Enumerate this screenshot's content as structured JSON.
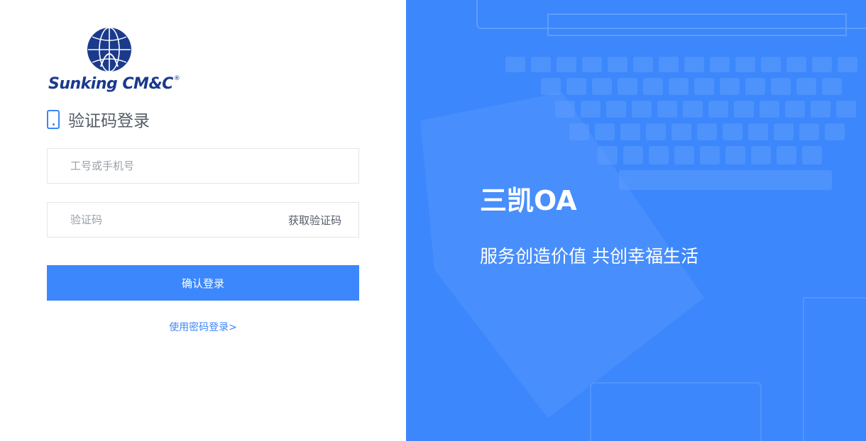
{
  "logo": {
    "text": "Sunking CM&C",
    "registered_mark": "®"
  },
  "login": {
    "title": "验证码登录",
    "username_placeholder": "工号或手机号",
    "code_placeholder": "验证码",
    "get_code_label": "获取验证码",
    "submit_label": "确认登录",
    "switch_label": "使用密码登录>"
  },
  "hero": {
    "brand": "三凯OA",
    "slogan": "服务创造价值 共创幸福生活"
  },
  "colors": {
    "accent": "#3c87fc",
    "logo_navy": "#1b3a8c",
    "text_gray": "#555b66",
    "border": "#e3e5e8"
  },
  "icons": {
    "heading_icon": "phone-icon",
    "logo_icon": "globe-emblem-icon"
  }
}
